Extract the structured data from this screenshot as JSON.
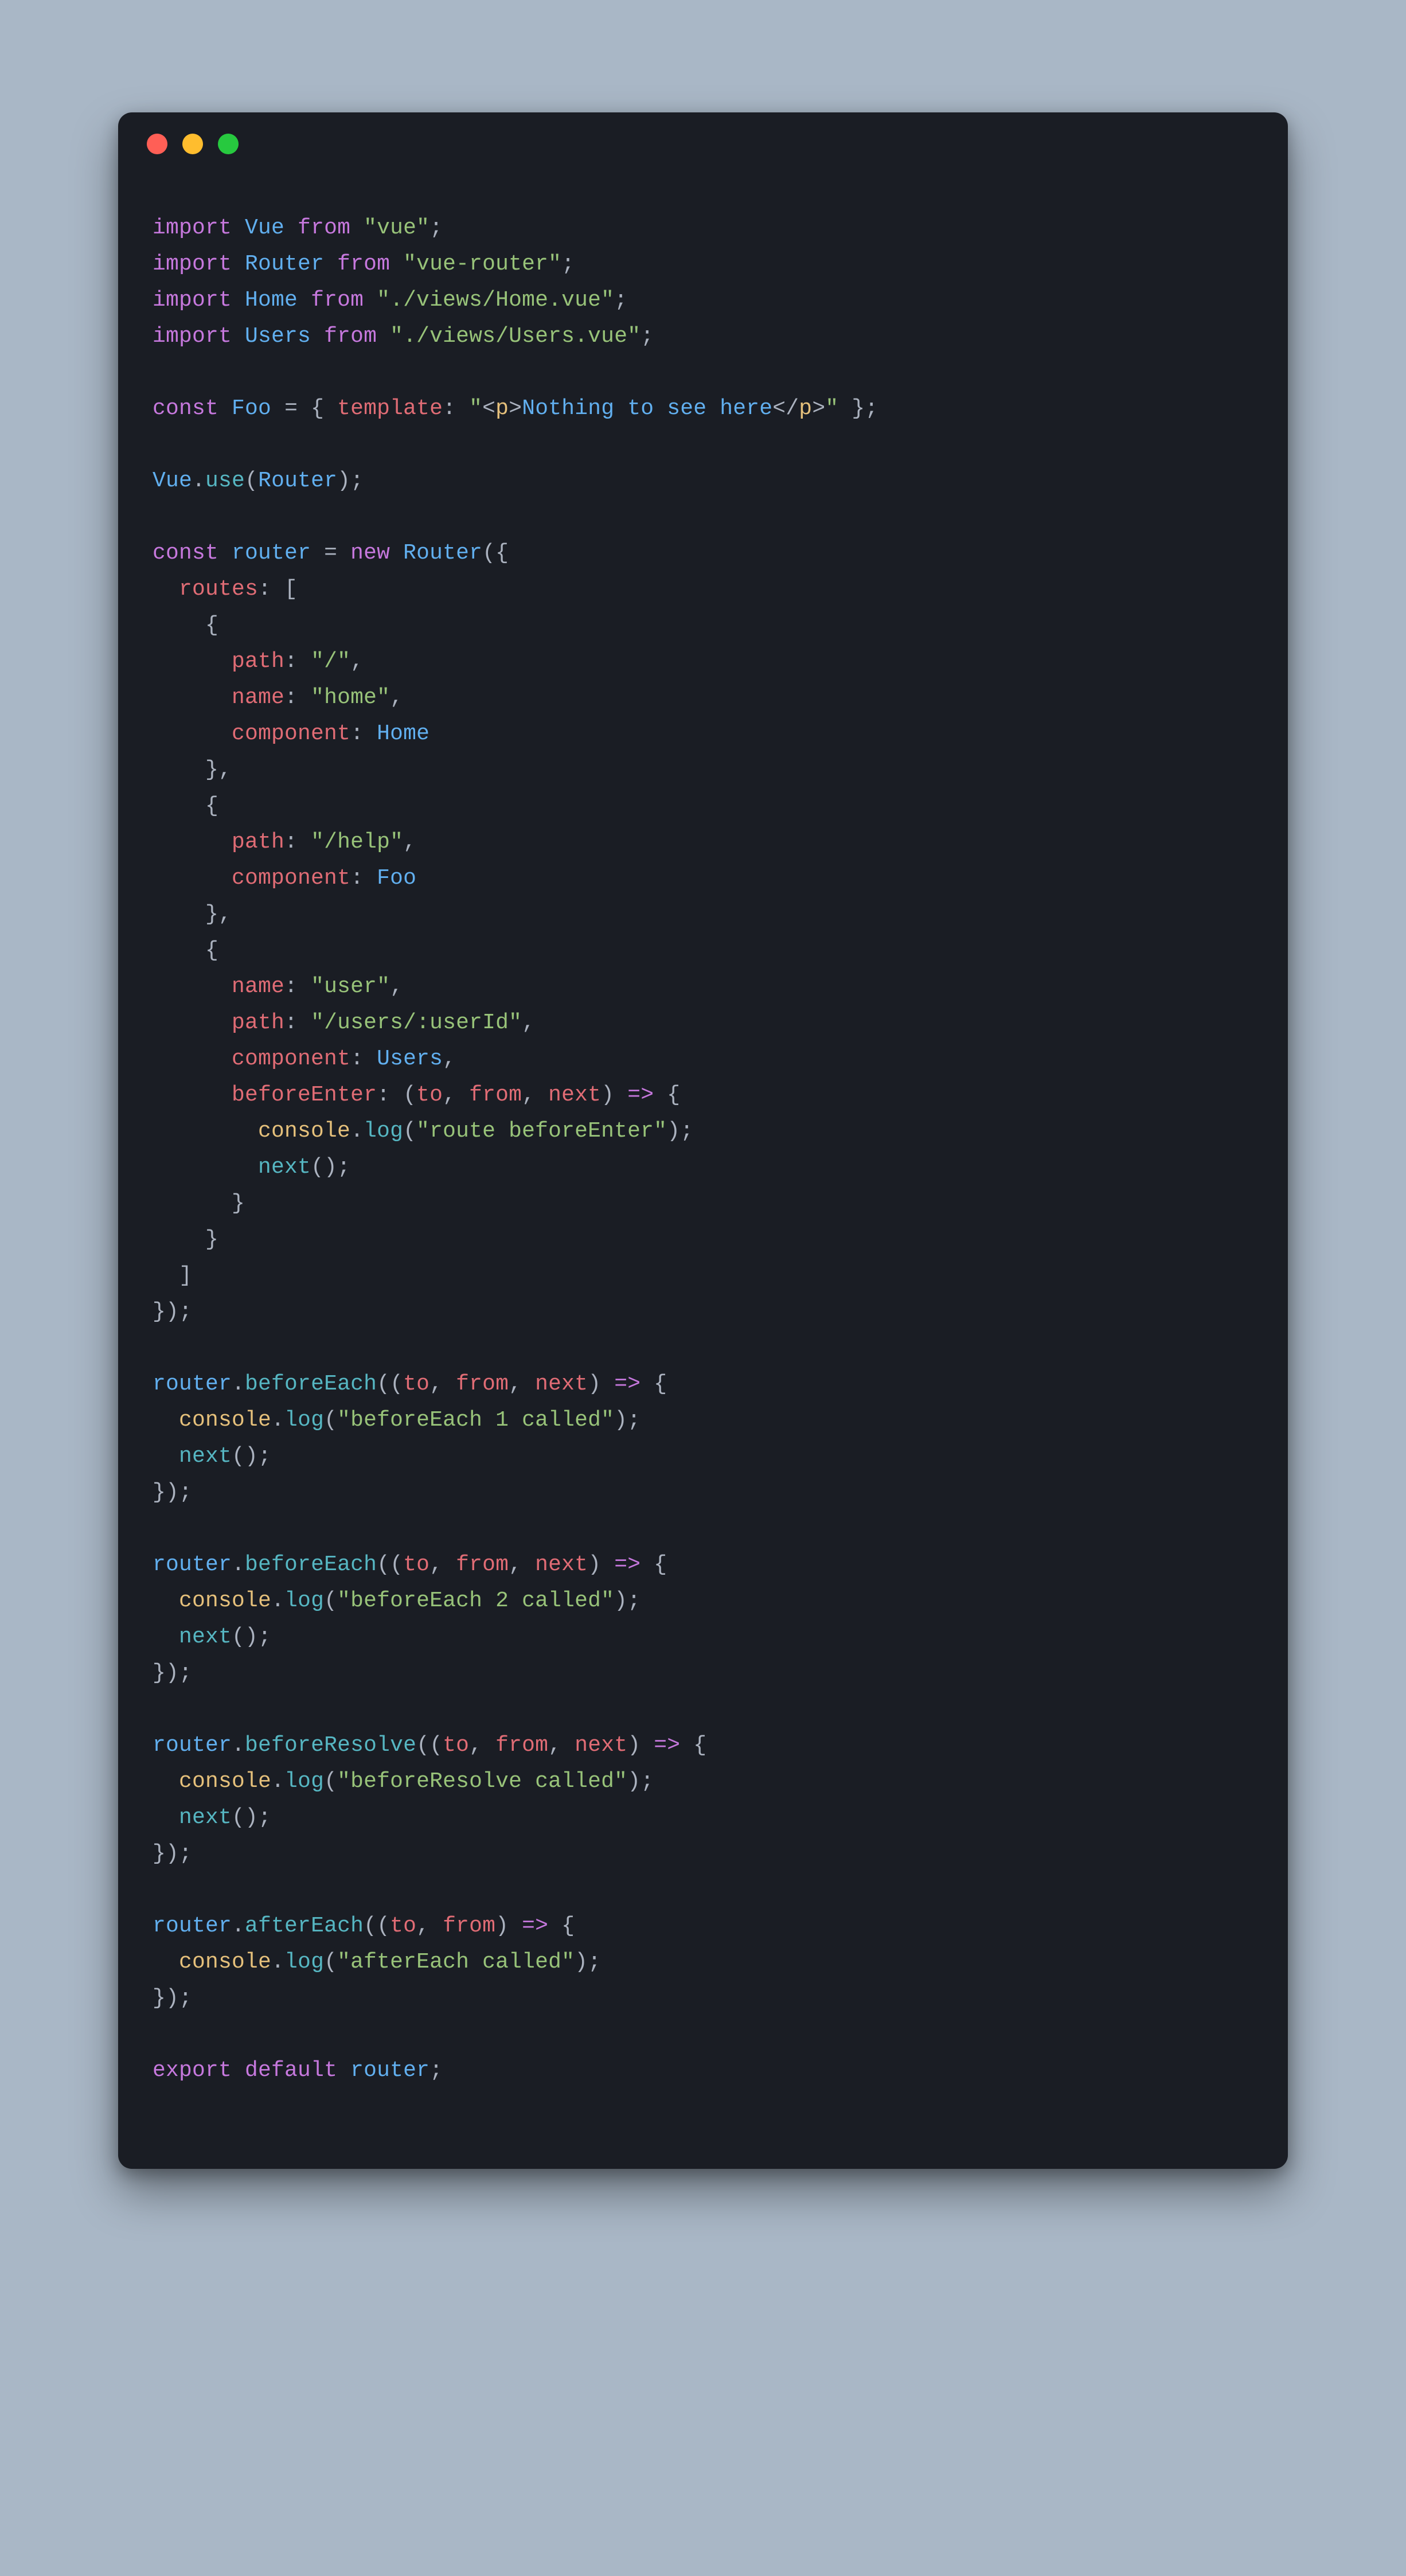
{
  "colors": {
    "background": "#A9B7C6",
    "window_bg": "#1a1d24",
    "keyword": "#c678dd",
    "ident": "#61afef",
    "prop": "#e06c75",
    "string": "#98c379",
    "plain": "#abb2bf",
    "func": "#56b6c2",
    "yellow": "#e5c07b",
    "dot_red": "#ff5f56",
    "dot_yellow": "#ffbd2e",
    "dot_green": "#27c93f"
  },
  "traffic_lights": [
    "close-icon",
    "minimize-icon",
    "maximize-icon"
  ],
  "code": {
    "l1": {
      "kw_import": "import",
      "id_vue": "Vue",
      "kw_from": "from",
      "str_vue": "\"vue\"",
      "semi": ";"
    },
    "l2": {
      "kw_import": "import",
      "id_router": "Router",
      "kw_from": "from",
      "str": "\"vue-router\"",
      "semi": ";"
    },
    "l3": {
      "kw_import": "import",
      "id_home": "Home",
      "kw_from": "from",
      "str": "\"./views/Home.vue\"",
      "semi": ";"
    },
    "l4": {
      "kw_import": "import",
      "id_users": "Users",
      "kw_from": "from",
      "str": "\"./views/Users.vue\"",
      "semi": ";"
    },
    "l6": {
      "kw_const": "const",
      "id_foo": "Foo",
      "eq": " = { ",
      "prop_template": "template",
      "colon": ": ",
      "q1": "\"",
      "lt": "<",
      "tag_p": "p",
      "gt": ">",
      "txt_nothing": "Nothing to see here",
      "lt2": "</",
      "tag_p2": "p",
      "gt2": ">",
      "q2": "\"",
      "close": " };"
    },
    "l8": {
      "id_vue": "Vue",
      "dot": ".",
      "fn_use": "use",
      "open": "(",
      "id_router": "Router",
      "close": ");"
    },
    "l10": {
      "kw_const": "const",
      "id_routerv": "router",
      "eq": " = ",
      "kw_new": "new",
      "sp": " ",
      "id_router": "Router",
      "open": "({"
    },
    "l11": {
      "indent": "  ",
      "prop_routes": "routes",
      "rest": ": ["
    },
    "l12": {
      "indent": "    ",
      "brace": "{"
    },
    "l13": {
      "indent": "      ",
      "prop_path": "path",
      "rest": ": ",
      "str": "\"/\"",
      "comma": ","
    },
    "l14": {
      "indent": "      ",
      "prop_name": "name",
      "rest": ": ",
      "str": "\"home\"",
      "comma": ","
    },
    "l15": {
      "indent": "      ",
      "prop_component": "component",
      "rest": ": ",
      "id_home": "Home"
    },
    "l16": {
      "indent": "    ",
      "brace": "},"
    },
    "l17": {
      "indent": "    ",
      "brace": "{"
    },
    "l18": {
      "indent": "      ",
      "prop_path": "path",
      "rest": ": ",
      "str": "\"/help\"",
      "comma": ","
    },
    "l19": {
      "indent": "      ",
      "prop_component": "component",
      "rest": ": ",
      "id_foo": "Foo"
    },
    "l20": {
      "indent": "    ",
      "brace": "},"
    },
    "l21": {
      "indent": "    ",
      "brace": "{"
    },
    "l22": {
      "indent": "      ",
      "prop_name": "name",
      "rest": ": ",
      "str": "\"user\"",
      "comma": ","
    },
    "l23": {
      "indent": "      ",
      "prop_path": "path",
      "rest": ": ",
      "str": "\"/users/:userId\"",
      "comma": ","
    },
    "l24": {
      "indent": "      ",
      "prop_component": "component",
      "rest": ": ",
      "id_users": "Users",
      "comma": ","
    },
    "l25": {
      "indent": "      ",
      "prop_before": "beforeEnter",
      "rest": ": (",
      "a_to": "to",
      "c1": ", ",
      "a_from": "from",
      "c2": ", ",
      "a_next": "next",
      "arrow": ") ",
      "kw_arrow": "=>",
      "brace": " {"
    },
    "l26": {
      "indent": "        ",
      "id_console": "console",
      "dot": ".",
      "fn_log": "log",
      "open": "(",
      "str": "\"route beforeEnter\"",
      "close": ");"
    },
    "l27": {
      "indent": "        ",
      "fn_next": "next",
      "rest": "();"
    },
    "l28": {
      "indent": "      ",
      "brace": "}"
    },
    "l29": {
      "indent": "    ",
      "brace": "}"
    },
    "l30": {
      "indent": "  ",
      "bracket": "]"
    },
    "l31": {
      "close": "});"
    },
    "l33": {
      "id_routerv": "router",
      "dot": ".",
      "fn": "beforeEach",
      "open": "((",
      "a_to": "to",
      "c1": ", ",
      "a_from": "from",
      "c2": ", ",
      "a_next": "next",
      "close": ") ",
      "kw_arrow": "=>",
      "brace": " {"
    },
    "l34": {
      "indent": "  ",
      "id_console": "console",
      "dot": ".",
      "fn_log": "log",
      "open": "(",
      "str": "\"beforeEach 1 called\"",
      "close": ");"
    },
    "l35": {
      "indent": "  ",
      "fn_next": "next",
      "rest": "();"
    },
    "l36": {
      "close": "});"
    },
    "l38": {
      "id_routerv": "router",
      "dot": ".",
      "fn": "beforeEach",
      "open": "((",
      "a_to": "to",
      "c1": ", ",
      "a_from": "from",
      "c2": ", ",
      "a_next": "next",
      "close": ") ",
      "kw_arrow": "=>",
      "brace": " {"
    },
    "l39": {
      "indent": "  ",
      "id_console": "console",
      "dot": ".",
      "fn_log": "log",
      "open": "(",
      "str": "\"beforeEach 2 called\"",
      "close": ");"
    },
    "l40": {
      "indent": "  ",
      "fn_next": "next",
      "rest": "();"
    },
    "l41": {
      "close": "});"
    },
    "l43": {
      "id_routerv": "router",
      "dot": ".",
      "fn": "beforeResolve",
      "open": "((",
      "a_to": "to",
      "c1": ", ",
      "a_from": "from",
      "c2": ", ",
      "a_next": "next",
      "close": ") ",
      "kw_arrow": "=>",
      "brace": " {"
    },
    "l44": {
      "indent": "  ",
      "id_console": "console",
      "dot": ".",
      "fn_log": "log",
      "open": "(",
      "str": "\"beforeResolve called\"",
      "close": ");"
    },
    "l45": {
      "indent": "  ",
      "fn_next": "next",
      "rest": "();"
    },
    "l46": {
      "close": "});"
    },
    "l48": {
      "id_routerv": "router",
      "dot": ".",
      "fn": "afterEach",
      "open": "((",
      "a_to": "to",
      "c1": ", ",
      "a_from": "from",
      "close": ") ",
      "kw_arrow": "=>",
      "brace": " {"
    },
    "l49": {
      "indent": "  ",
      "id_console": "console",
      "dot": ".",
      "fn_log": "log",
      "open": "(",
      "str": "\"afterEach called\"",
      "close": ");"
    },
    "l50": {
      "close": "});"
    },
    "l52": {
      "kw_export": "export",
      "sp": " ",
      "kw_default": "default",
      "sp2": " ",
      "id_routerv": "router",
      "semi": ";"
    }
  }
}
